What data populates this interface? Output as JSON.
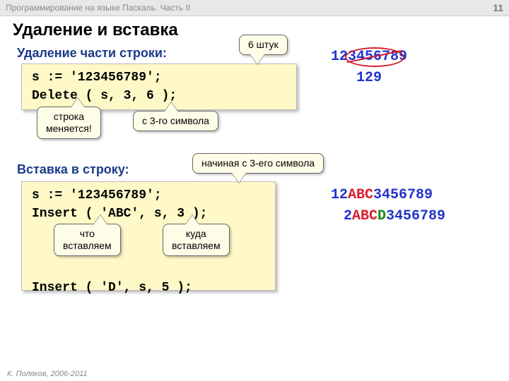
{
  "header": {
    "course": "Программирование на языке Паскаль. Часть II",
    "page": "11"
  },
  "slide_title": "Удаление и вставка",
  "section1": {
    "heading": "Удаление части строки:",
    "code": "s := '123456789';\nDelete ( s, 3, 6 );",
    "callout_count": "6 штук",
    "callout_changes": "строка\nменяется!",
    "callout_from": "с 3-го символа",
    "result_before_prefix": "12",
    "result_before_mid": "345678",
    "result_before_suffix": "9",
    "result_after": "129"
  },
  "section2": {
    "heading": "Вставка в строку:",
    "code_part1": "s := '123456789';\nInsert ( 'ABC', s, 3 );",
    "code_part2": "Insert ( 'D', s, 5 );",
    "callout_start": "начиная с 3-его символа",
    "callout_what": "что\nвставляем",
    "callout_where": "куда\nвставляем",
    "result1_a": "12",
    "result1_b": "ABC",
    "result1_c": "3456789",
    "result2_a": "2",
    "result2_b": "ABC",
    "result2_c": "D",
    "result2_d": "3456789"
  },
  "footer": " К. Поляков, 2006-2011"
}
